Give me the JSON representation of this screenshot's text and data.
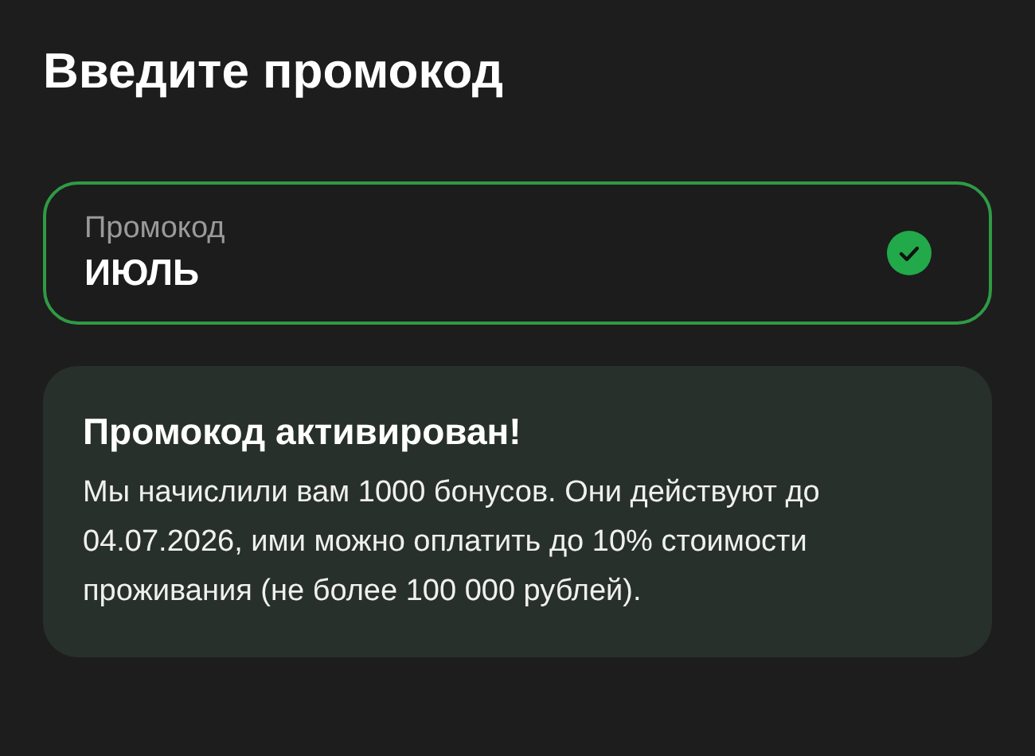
{
  "title": "Введите промокод",
  "promo_field": {
    "label": "Промокод",
    "value": "ИЮЛЬ",
    "valid": true
  },
  "result_card": {
    "title": "Промокод активирован!",
    "message": "Мы начислили вам 1000 бонусов. Они действуют до 04.07.2026, ими можно оплатить до 10% стоимости проживания (не более 100 000 рублей)."
  }
}
